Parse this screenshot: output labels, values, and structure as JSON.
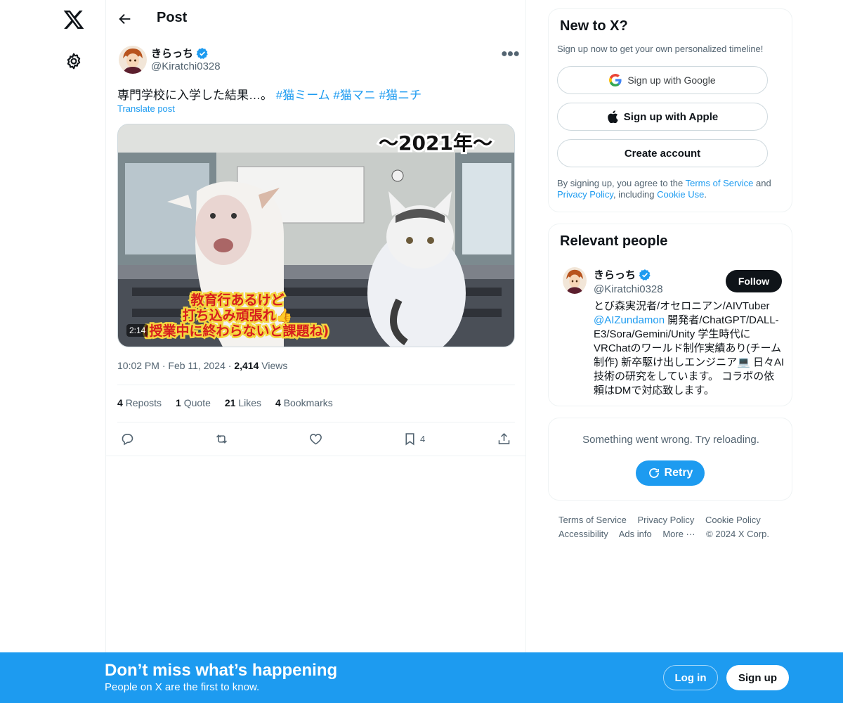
{
  "colors": {
    "accent": "#1d9bf0",
    "text": "#0f1419",
    "secondary": "#536471"
  },
  "nav": {
    "logo_icon": "x-logo-icon",
    "settings_icon": "gear-icon"
  },
  "header": {
    "title": "Post",
    "back_icon": "arrow-left-icon"
  },
  "post": {
    "author_name": "きらっち",
    "author_handle": "@Kiratchi0328",
    "text": "専門学校に入学した結果…。",
    "hashtags": [
      "#猫ミーム",
      "#猫マニ",
      "#猫ニチ"
    ],
    "translate_label": "Translate post",
    "media": {
      "overlay_title": "～2021年～",
      "caption_line1": "教育行あるけど",
      "caption_line2": "打ち込み頑張れ👍",
      "caption_line3": "(授業中に終わらないと課題ね)",
      "duration": "2:14"
    },
    "time": "10:02 PM",
    "date": "Feb 11, 2024",
    "views_count": "2,414",
    "views_label": "Views",
    "stats": [
      {
        "count": "4",
        "label": "Reposts"
      },
      {
        "count": "1",
        "label": "Quote"
      },
      {
        "count": "21",
        "label": "Likes"
      },
      {
        "count": "4",
        "label": "Bookmarks"
      }
    ],
    "bookmark_count": "4"
  },
  "signup_card": {
    "title": "New to X?",
    "subtitle": "Sign up now to get your own personalized timeline!",
    "google_label": "Sign up with Google",
    "apple_label": "Sign up with Apple",
    "create_label": "Create account",
    "legal_prefix": "By signing up, you agree to the ",
    "terms_link": "Terms of Service",
    "legal_and": " and ",
    "privacy_link": "Privacy Policy",
    "legal_including": ", including ",
    "cookie_link": "Cookie Use",
    "legal_end": "."
  },
  "relevant_people": {
    "title": "Relevant people",
    "name": "きらっち",
    "handle": "@Kiratchi0328",
    "follow_label": "Follow",
    "bio_part1": "とび森実況者/オセロニアン/AIVTuber ",
    "bio_mention": "@AIZundamon",
    "bio_part2": " 開発者/ChatGPT/DALL-E3/Sora/Gemini/Unity 学生時代にVRChatのワールド制作実績あり(チーム制作) 新卒駆け出しエンジニア💻 日々AI技術の研究をしています。 コラボの依頼はDMで対応致します。"
  },
  "error_card": {
    "message": "Something went wrong. Try reloading.",
    "retry_label": "Retry"
  },
  "footer_links": [
    "Terms of Service",
    "Privacy Policy",
    "Cookie Policy",
    "Accessibility",
    "Ads info",
    "More ···",
    "© 2024 X Corp."
  ],
  "banner": {
    "title": "Don’t miss what’s happening",
    "subtitle": "People on X are the first to know.",
    "login_label": "Log in",
    "signup_label": "Sign up"
  }
}
